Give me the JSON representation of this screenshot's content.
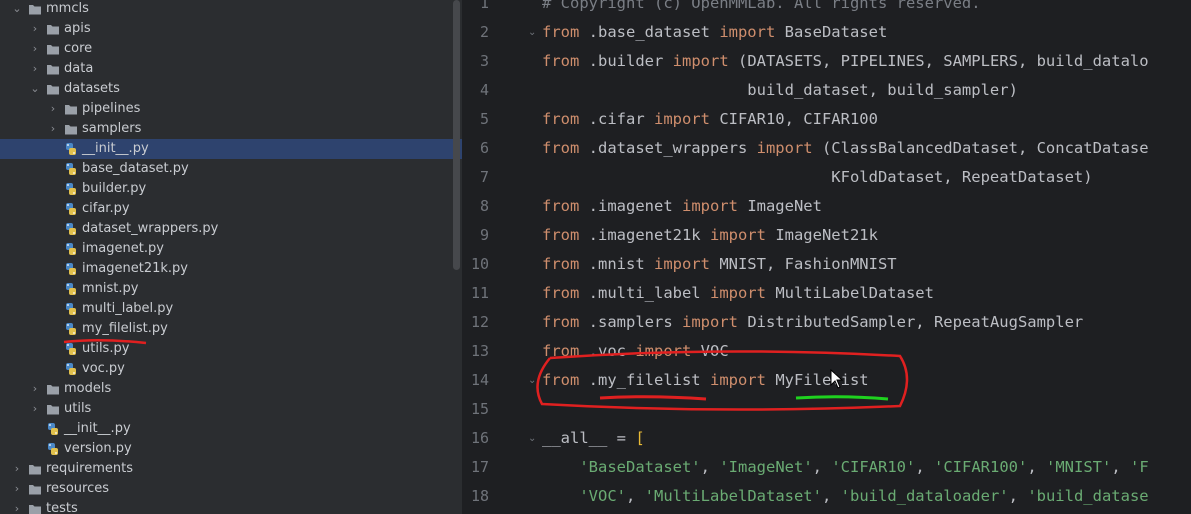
{
  "tree": {
    "items": [
      {
        "label": "mmcls",
        "type": "folder",
        "expanded": true,
        "indent": 0
      },
      {
        "label": "apis",
        "type": "folder",
        "expanded": false,
        "indent": 1
      },
      {
        "label": "core",
        "type": "folder",
        "expanded": false,
        "indent": 1
      },
      {
        "label": "data",
        "type": "folder",
        "expanded": false,
        "indent": 1
      },
      {
        "label": "datasets",
        "type": "folder",
        "expanded": true,
        "indent": 1
      },
      {
        "label": "pipelines",
        "type": "folder",
        "expanded": false,
        "indent": 2
      },
      {
        "label": "samplers",
        "type": "folder",
        "expanded": false,
        "indent": 2
      },
      {
        "label": "__init__.py",
        "type": "py",
        "indent": 2,
        "selected": true
      },
      {
        "label": "base_dataset.py",
        "type": "py",
        "indent": 2
      },
      {
        "label": "builder.py",
        "type": "py",
        "indent": 2
      },
      {
        "label": "cifar.py",
        "type": "py",
        "indent": 2
      },
      {
        "label": "dataset_wrappers.py",
        "type": "py",
        "indent": 2
      },
      {
        "label": "imagenet.py",
        "type": "py",
        "indent": 2
      },
      {
        "label": "imagenet21k.py",
        "type": "py",
        "indent": 2
      },
      {
        "label": "mnist.py",
        "type": "py",
        "indent": 2
      },
      {
        "label": "multi_label.py",
        "type": "py",
        "indent": 2
      },
      {
        "label": "my_filelist.py",
        "type": "py",
        "indent": 2
      },
      {
        "label": "utils.py",
        "type": "py",
        "indent": 2
      },
      {
        "label": "voc.py",
        "type": "py",
        "indent": 2
      },
      {
        "label": "models",
        "type": "folder",
        "expanded": false,
        "indent": 1
      },
      {
        "label": "utils",
        "type": "folder",
        "expanded": false,
        "indent": 1
      },
      {
        "label": "__init__.py",
        "type": "py",
        "indent": 1
      },
      {
        "label": "version.py",
        "type": "py",
        "indent": 1
      },
      {
        "label": "requirements",
        "type": "folder",
        "expanded": false,
        "indent": 0
      },
      {
        "label": "resources",
        "type": "folder",
        "expanded": false,
        "indent": 0
      },
      {
        "label": "tests",
        "type": "folder",
        "expanded": false,
        "indent": 0
      }
    ],
    "folder_color": "#9aa0a8",
    "selected_color": "#2e436e"
  },
  "editor": {
    "lines": [
      {
        "n": "1",
        "fold": false,
        "tokens": [
          [
            "cm",
            "# Copyright (c) OpenMMLab. All rights reserved."
          ]
        ]
      },
      {
        "n": "2",
        "fold": true,
        "tokens": [
          [
            "kw",
            "from"
          ],
          [
            "id",
            " .base_dataset "
          ],
          [
            "kw",
            "import"
          ],
          [
            "id",
            " BaseDataset"
          ]
        ]
      },
      {
        "n": "3",
        "fold": false,
        "tokens": [
          [
            "kw",
            "from"
          ],
          [
            "id",
            " .builder "
          ],
          [
            "kw",
            "import"
          ],
          [
            "id",
            " (DATASETS, PIPELINES, SAMPLERS, build_datalo"
          ]
        ]
      },
      {
        "n": "4",
        "fold": false,
        "tokens": [
          [
            "id",
            "                      build_dataset, build_sampler)"
          ]
        ]
      },
      {
        "n": "5",
        "fold": false,
        "tokens": [
          [
            "kw",
            "from"
          ],
          [
            "id",
            " .cifar "
          ],
          [
            "kw",
            "import"
          ],
          [
            "id",
            " CIFAR10, CIFAR100"
          ]
        ]
      },
      {
        "n": "6",
        "fold": false,
        "tokens": [
          [
            "kw",
            "from"
          ],
          [
            "id",
            " .dataset_wrappers "
          ],
          [
            "kw",
            "import"
          ],
          [
            "id",
            " (ClassBalancedDataset, ConcatDatase"
          ]
        ]
      },
      {
        "n": "7",
        "fold": false,
        "tokens": [
          [
            "id",
            "                               KFoldDataset, RepeatDataset)"
          ]
        ]
      },
      {
        "n": "8",
        "fold": false,
        "tokens": [
          [
            "kw",
            "from"
          ],
          [
            "id",
            " .imagenet "
          ],
          [
            "kw",
            "import"
          ],
          [
            "id",
            " ImageNet"
          ]
        ]
      },
      {
        "n": "9",
        "fold": false,
        "tokens": [
          [
            "kw",
            "from"
          ],
          [
            "id",
            " .imagenet21k "
          ],
          [
            "kw",
            "import"
          ],
          [
            "id",
            " ImageNet21k"
          ]
        ]
      },
      {
        "n": "10",
        "fold": false,
        "tokens": [
          [
            "kw",
            "from"
          ],
          [
            "id",
            " .mnist "
          ],
          [
            "kw",
            "import"
          ],
          [
            "id",
            " MNIST, FashionMNIST"
          ]
        ]
      },
      {
        "n": "11",
        "fold": false,
        "tokens": [
          [
            "kw",
            "from"
          ],
          [
            "id",
            " .multi_label "
          ],
          [
            "kw",
            "import"
          ],
          [
            "id",
            " MultiLabelDataset"
          ]
        ]
      },
      {
        "n": "12",
        "fold": false,
        "tokens": [
          [
            "kw",
            "from"
          ],
          [
            "id",
            " .samplers "
          ],
          [
            "kw",
            "import"
          ],
          [
            "id",
            " DistributedSampler, RepeatAugSampler"
          ]
        ]
      },
      {
        "n": "13",
        "fold": false,
        "tokens": [
          [
            "kw",
            "from"
          ],
          [
            "id",
            " .voc "
          ],
          [
            "kw",
            "import"
          ],
          [
            "id",
            " VOC"
          ]
        ]
      },
      {
        "n": "14",
        "fold": true,
        "tokens": [
          [
            "kw",
            "from"
          ],
          [
            "id",
            " .my_filelist "
          ],
          [
            "kw",
            "import"
          ],
          [
            "id",
            " MyFilelist"
          ]
        ]
      },
      {
        "n": "15",
        "fold": false,
        "tokens": [
          [
            "id",
            ""
          ]
        ]
      },
      {
        "n": "16",
        "fold": true,
        "tokens": [
          [
            "id",
            "__all__ = "
          ],
          [
            "br",
            "["
          ]
        ]
      },
      {
        "n": "17",
        "fold": false,
        "tokens": [
          [
            "id",
            "    "
          ],
          [
            "str",
            "'BaseDataset'"
          ],
          [
            "id",
            ", "
          ],
          [
            "str",
            "'ImageNet'"
          ],
          [
            "id",
            ", "
          ],
          [
            "str",
            "'CIFAR10'"
          ],
          [
            "id",
            ", "
          ],
          [
            "str",
            "'CIFAR100'"
          ],
          [
            "id",
            ", "
          ],
          [
            "str",
            "'MNIST'"
          ],
          [
            "id",
            ", "
          ],
          [
            "str",
            "'F"
          ]
        ]
      },
      {
        "n": "18",
        "fold": false,
        "tokens": [
          [
            "id",
            "    "
          ],
          [
            "str",
            "'VOC'"
          ],
          [
            "id",
            ", "
          ],
          [
            "str",
            "'MultiLabelDataset'"
          ],
          [
            "id",
            ", "
          ],
          [
            "str",
            "'build_dataloader'"
          ],
          [
            "id",
            ", "
          ],
          [
            "str",
            "'build_datase"
          ]
        ]
      }
    ]
  },
  "icons": {
    "cursor": "mouse-pointer-icon",
    "folder": "folder-icon",
    "python": "python-file-icon",
    "chevron": "chevron-icon"
  }
}
